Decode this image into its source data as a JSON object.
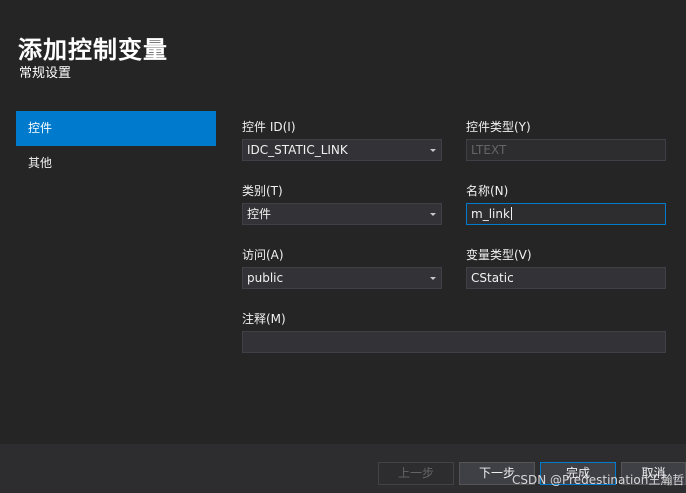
{
  "header": {
    "title": "添加控制变量",
    "subtitle": "常规设置"
  },
  "sidebar": {
    "items": [
      {
        "label": "控件",
        "active": true
      },
      {
        "label": "其他",
        "active": false
      }
    ]
  },
  "form": {
    "control_id": {
      "label": "控件 ID(I)",
      "value": "IDC_STATIC_LINK"
    },
    "control_type": {
      "label": "控件类型(Y)",
      "value": "LTEXT"
    },
    "category": {
      "label": "类别(T)",
      "value": "控件"
    },
    "name": {
      "label": "名称(N)",
      "value": "m_link"
    },
    "access": {
      "label": "访问(A)",
      "value": "public"
    },
    "var_type": {
      "label": "变量类型(V)",
      "value": "CStatic"
    },
    "comment": {
      "label": "注释(M)",
      "value": ""
    }
  },
  "buttons": {
    "prev": "上一步",
    "next": "下一步",
    "finish": "完成",
    "cancel": "取消"
  },
  "watermark": "CSDN @Predestination王瀚哲",
  "colors": {
    "background": "#252526",
    "accent": "#007acc",
    "field": "#333337"
  }
}
